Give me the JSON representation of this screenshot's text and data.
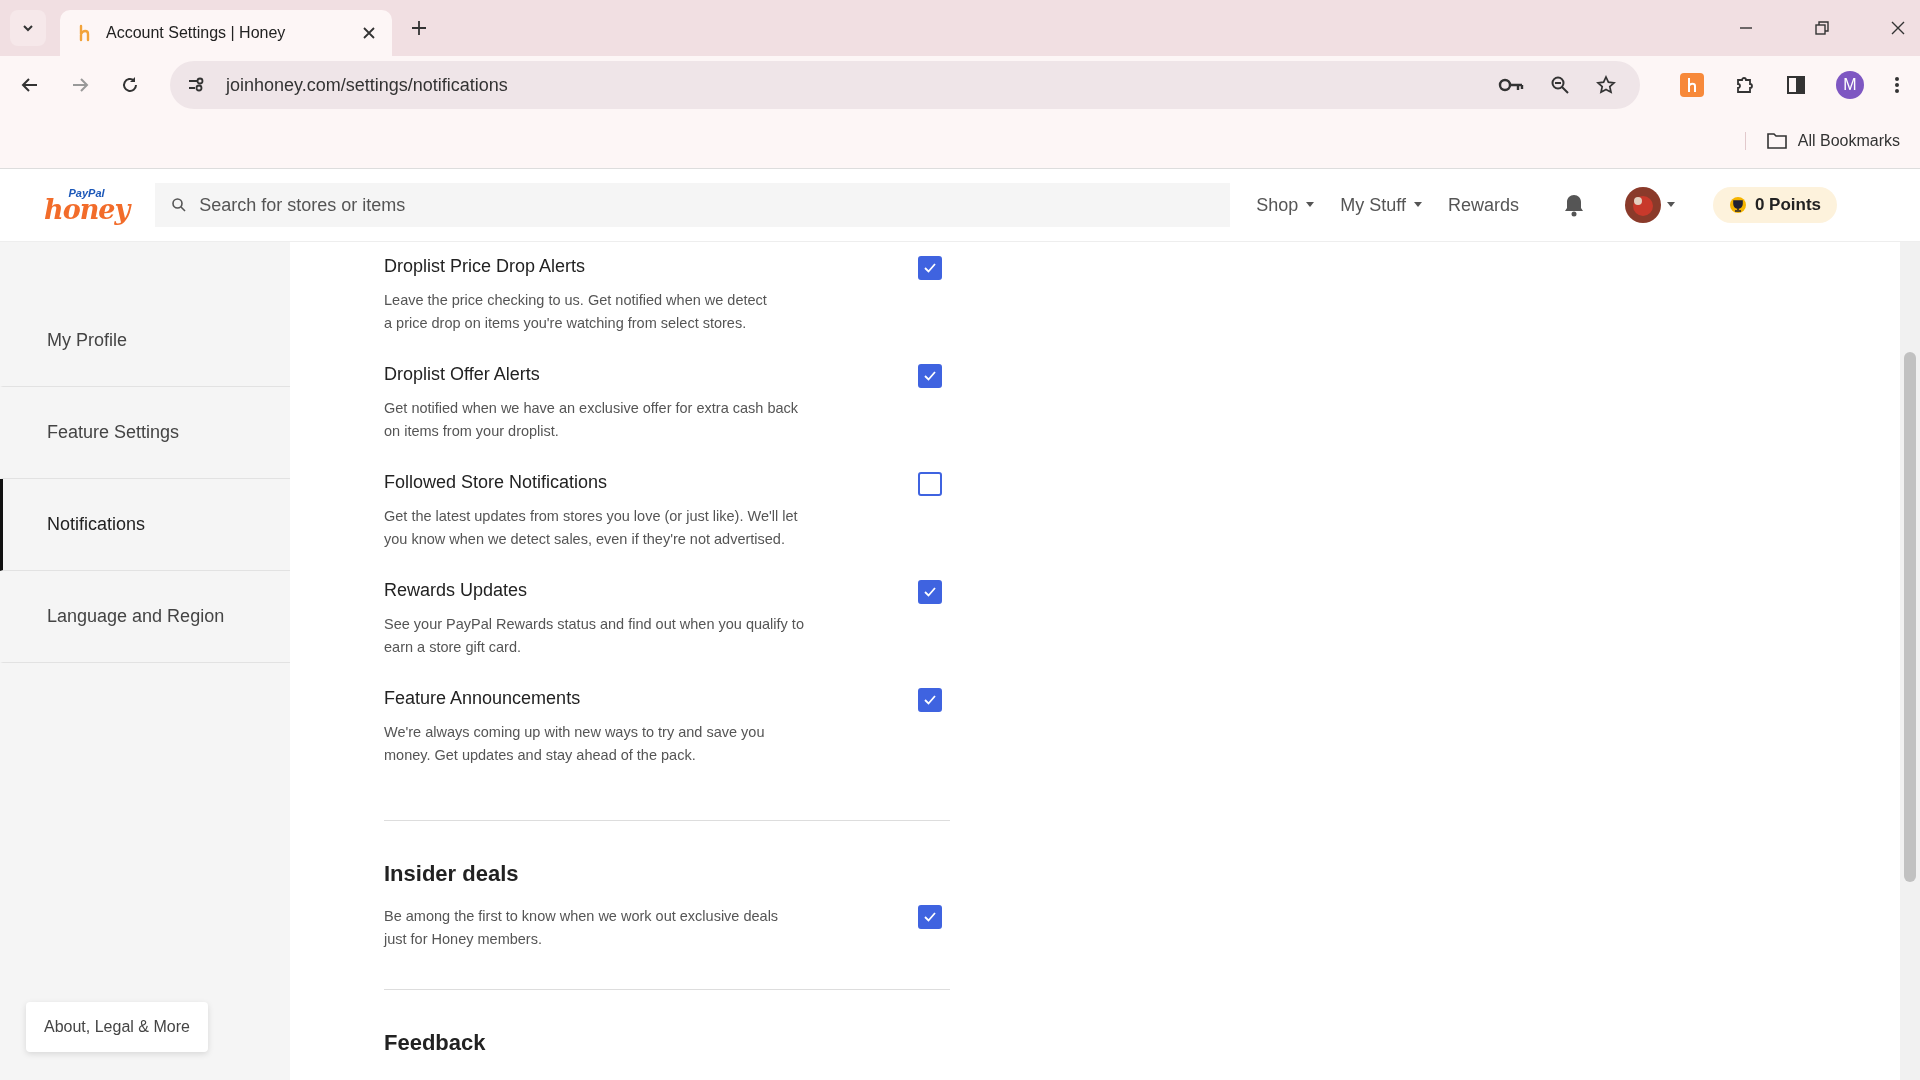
{
  "browser": {
    "tab_title": "Account Settings | Honey",
    "url": "joinhoney.com/settings/notifications",
    "bookmarks_folder": "All Bookmarks",
    "profile_initial": "M"
  },
  "site_header": {
    "logo_top": "PayPal",
    "logo_main": "honey",
    "search": {
      "placeholder": "Search for stores or items"
    },
    "nav": [
      {
        "label": "Shop",
        "dropdown": true
      },
      {
        "label": "My Stuff",
        "dropdown": true
      },
      {
        "label": "Rewards",
        "dropdown": false
      }
    ],
    "points": "0 Points"
  },
  "sidebar": {
    "items": [
      {
        "label": "My Profile",
        "selected": false
      },
      {
        "label": "Feature Settings",
        "selected": false
      },
      {
        "label": "Notifications",
        "selected": true
      },
      {
        "label": "Language and Region",
        "selected": false
      }
    ],
    "footer_button": "About, Legal & More"
  },
  "notifications": [
    {
      "title": "Droplist Price Drop Alerts",
      "description": "Leave the price checking to us. Get notified when we detect\na price drop on items you're watching from select stores.",
      "checked": true
    },
    {
      "title": "Droplist Offer Alerts",
      "description": "Get notified when we have an exclusive offer for extra cash back\non items from your droplist.",
      "checked": true
    },
    {
      "title": "Followed Store Notifications",
      "description": "Get the latest updates from stores you love (or just like). We'll let\nyou know when we detect sales, even if they're not advertised.",
      "checked": false
    },
    {
      "title": "Rewards Updates",
      "description": "See your PayPal Rewards status and find out when you qualify to\nearn a store gift card.",
      "checked": true
    },
    {
      "title": "Feature Announcements",
      "description": "We're always coming up with new ways to try and save you\nmoney. Get updates and stay ahead of the pack.",
      "checked": true
    }
  ],
  "sections": [
    {
      "heading": "Insider deals",
      "description": "Be among the first to know when we work out exclusive deals\njust for Honey members.",
      "checked": true
    },
    {
      "heading": "Feedback"
    }
  ]
}
